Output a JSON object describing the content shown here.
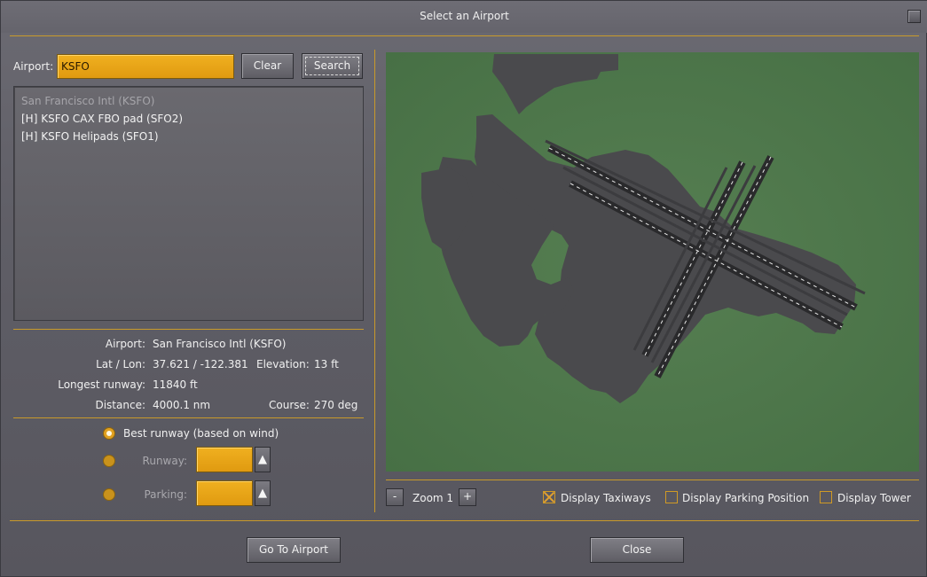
{
  "window": {
    "title": "Select an Airport"
  },
  "search": {
    "label": "Airport:",
    "value": "KSFO",
    "clear_label": "Clear",
    "search_label": "Search"
  },
  "results": [
    {
      "text": "San Francisco Intl   (KSFO)",
      "selected": true
    },
    {
      "text": "[H] KSFO CAX FBO pad   (SFO2)",
      "selected": false
    },
    {
      "text": "[H] KSFO Helipads   (SFO1)",
      "selected": false
    }
  ],
  "info": {
    "airport_label": "Airport:",
    "airport_value": "San Francisco Intl (KSFO)",
    "latlon_label": "Lat / Lon:",
    "latlon_value": "37.621 / -122.381",
    "elevation_label": "Elevation:",
    "elevation_value": "13 ft",
    "longest_label": "Longest runway:",
    "longest_value": "11840 ft",
    "distance_label": "Distance:",
    "distance_value": "4000.1 nm",
    "course_label": "Course:",
    "course_value": "270 deg"
  },
  "options": {
    "best_runway_label": "Best runway  (based on wind)",
    "runway_label": "Runway:",
    "runway_value": "",
    "parking_label": "Parking:",
    "parking_value": "",
    "spin_glyph": "▲"
  },
  "map_controls": {
    "zoom_minus": "-",
    "zoom_label": "Zoom 1",
    "zoom_plus": "+",
    "taxiways_label": "Display Taxiways",
    "taxiways_checked": true,
    "parking_label": "Display Parking Position",
    "parking_checked": false,
    "tower_label": "Display Tower",
    "tower_checked": false
  },
  "footer": {
    "go_label": "Go To Airport",
    "close_label": "Close"
  },
  "colors": {
    "accent": "#e0a020",
    "map_background": "#4f7a4c",
    "land": "#4a4a4d"
  }
}
